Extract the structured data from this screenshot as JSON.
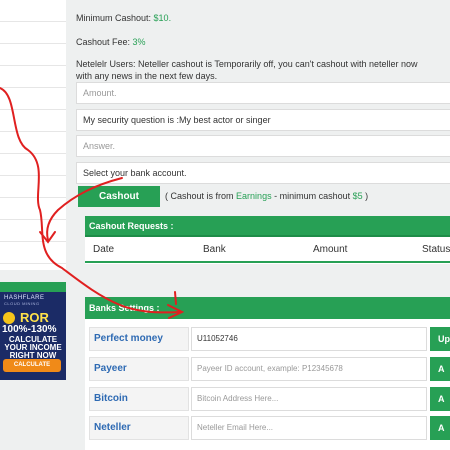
{
  "ad": {
    "brand": "HASHFLARE",
    "brand_sub": "CLOUD MINING",
    "ror": "ROR",
    "percent": "100%-130%",
    "line1": "CALCULATE",
    "line2": "YOUR INCOME",
    "line3": "RIGHT NOW",
    "cta": "CALCULATE"
  },
  "info": {
    "min_cashout_label": "Minimum Cashout:",
    "min_cashout_value": "$10.",
    "fee_label": "Cashout Fee:",
    "fee_value": "3%",
    "neteller_line1": "Netelelr Users: Neteller cashout is Temporarily off, you can't cashout with neteller now",
    "neteller_line2": "with any news in the next few days."
  },
  "form": {
    "amount_placeholder": "Amount.",
    "security_question": "My security question is :My best actor or singer",
    "answer_placeholder": "Answer.",
    "bank_select": "Select your bank account.",
    "cashout_button": "Cashout",
    "note_prefix": "( Cashout is from",
    "note_source": "Earnings",
    "note_mid": "- minimum cashout",
    "note_min": "$5",
    "note_suffix": ")"
  },
  "requests": {
    "title": "Cashout Requests :",
    "columns": [
      "Date",
      "Bank",
      "Amount",
      "Status"
    ]
  },
  "banks": {
    "title": "Banks Settings :",
    "rows": [
      {
        "label": "Perfect money",
        "value": "U11052746",
        "placeholder": "",
        "button": "Up"
      },
      {
        "label": "Payeer",
        "value": "",
        "placeholder": "Payeer ID account, example: P12345678",
        "button": "A"
      },
      {
        "label": "Bitcoin",
        "value": "",
        "placeholder": "Bitcoin Address Here...",
        "button": "A"
      },
      {
        "label": "Neteller",
        "value": "",
        "placeholder": "Neteller Email Here...",
        "button": "A"
      }
    ]
  },
  "colors": {
    "accent": "#27a055",
    "annotation": "#e02020",
    "link": "#2e6ab3"
  }
}
